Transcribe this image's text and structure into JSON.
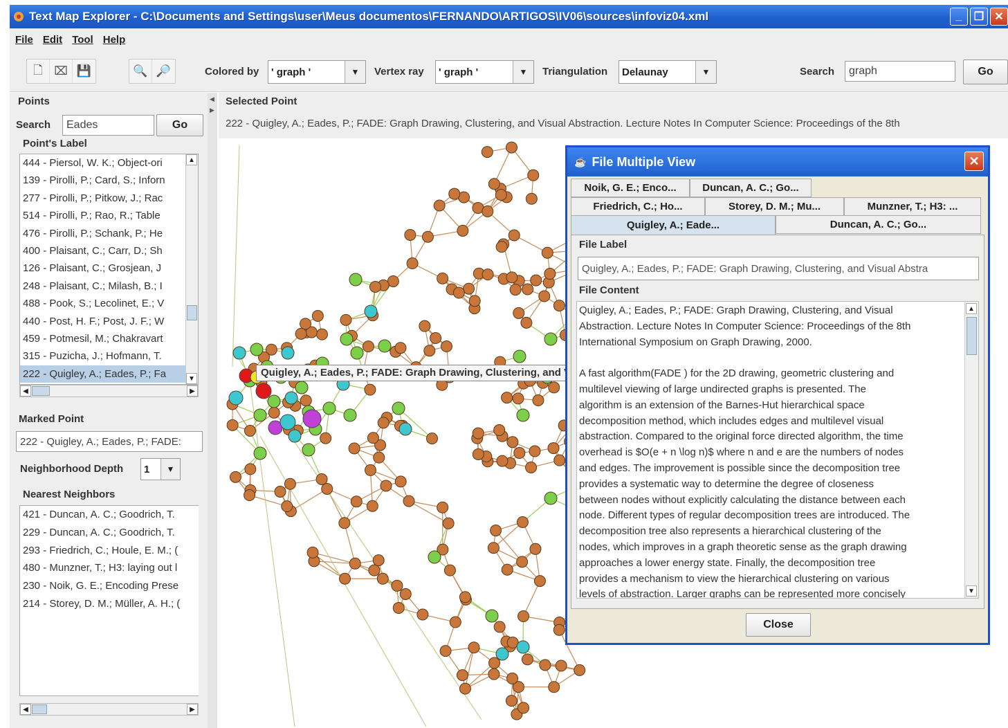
{
  "window": {
    "title": "Text Map Explorer - C:\\Documents and Settings\\user\\Meus documentos\\FERNANDO\\ARTIGOS\\IV06\\sources\\infoviz04.xml"
  },
  "menu": [
    "File",
    "Edit",
    "Tool",
    "Help"
  ],
  "toolbar": {
    "colored_by_label": "Colored by",
    "colored_by_value": "' graph '",
    "vertex_ray_label": "Vertex ray",
    "vertex_ray_value": "' graph '",
    "triangulation_label": "Triangulation",
    "triangulation_value": "Delaunay",
    "search_label": "Search",
    "search_value": "graph",
    "go_label": "Go"
  },
  "points_panel": {
    "title": "Points",
    "search_label": "Search",
    "search_value": "Eades",
    "go_label": "Go",
    "list_title": "Point's Label",
    "items": [
      "444 - Piersol, W. K.; Object-ori",
      "139 - Pirolli, P.; Card, S.; Inforn",
      "277 - Pirolli, P.; Pitkow, J.; Rac",
      "514 - Pirolli, P.; Rao, R.; Table",
      "476 - Pirolli, P.; Schank, P.; He",
      "400 - Plaisant, C.; Carr, D.; Sh",
      "126 - Plaisant, C.; Grosjean, J",
      "248 - Plaisant, C.; Milash, B.; I",
      "488 - Pook, S.; Lecolinet, E.; V",
      "440 - Post, H. F.; Post, J. F.; W",
      "459 - Potmesil, M.; Chakravart",
      "315 - Puzicha, J.; Hofmann, T.",
      "222 - Quigley, A.; Eades, P.; Fa"
    ],
    "selected_index": 12,
    "marked_title": "Marked Point",
    "marked_value": "222 - Quigley, A.; Eades, P.; FADE:",
    "depth_label": "Neighborhood Depth",
    "depth_value": "1",
    "neighbors_title": "Nearest Neighbors",
    "neighbors": [
      "421 - Duncan, A. C.; Goodrich, T.",
      "229 - Duncan, A. C.; Goodrich, T.",
      "293 - Friedrich, C.; Houle, E. M.; (",
      "480 - Munzner, T.; H3: laying out l",
      "230 - Noik, G. E.; Encoding Prese",
      "214 - Storey, D. M.; Müller, A. H.; ("
    ]
  },
  "selected_point": {
    "title": "Selected Point",
    "value": "222 - Quigley, A.; Eades, P.; FADE: Graph Drawing, Clustering, and Visual Abstraction. Lecture Notes In Computer Science: Proceedings of the 8th"
  },
  "tooltip": "Quigley, A.; Eades, P.; FADE: Graph Drawing, Clustering, and Visual Abstraction",
  "dialog": {
    "title": "File Multiple View",
    "tabs_row1": [
      "Noik, G. E.; Enco...",
      "Duncan, A. C.; Go..."
    ],
    "tabs_row2": [
      "Friedrich, C.; Ho...",
      "Storey, D. M.; Mu...",
      "Munzner, T.; H3: ..."
    ],
    "tabs_row3": [
      "Quigley, A.; Eade...",
      "Duncan, A. C.; Go..."
    ],
    "file_label_title": "File Label",
    "file_label_value": "Quigley, A.; Eades, P.; FADE: Graph Drawing, Clustering, and Visual Abstra",
    "file_content_title": "File Content",
    "file_content": "Quigley, A.; Eades, P.; FADE: Graph Drawing, Clustering, and Visual\nAbstraction. Lecture Notes In Computer Science: Proceedings of the 8th\nInternational Symposium on Graph Drawing, 2000.\n\nA fast algorithm(FADE ) for the 2D drawing, geometric clustering and\nmultilevel viewing of large undirected graphs is presented. The\nalgorithm is an extension of the Barnes-Hut hierarchical space\ndecomposition method, which includes edges and multilevel visual\nabstraction. Compared to the original force directed algorithm, the time\noverhead is $O(e + n \\log n)$ where n and e are the numbers of nodes\nand edges. The improvement is possible since the decomposition tree\nprovides a systematic way to determine the degree of closeness\nbetween nodes without explicitly calculating the distance between each\nnode. Different types of regular decomposition trees are introduced. The\ndecomposition tree also represents a hierarchical clustering of the\nnodes, which improves in a graph theoretic sense as the graph drawing\napproaches a lower energy state. Finally, the decomposition tree\nprovides a mechanism to view the hierarchical clustering on various\nlevels of abstraction. Larger graphs can be represented more concisely",
    "close_label": "Close"
  },
  "colors": {
    "node": "#c8763a",
    "edge": "#c88a55",
    "highlight_node": "#7ccf4a",
    "cyan_node": "#3fc7cf",
    "red_node": "#e01818",
    "purple_node": "#c040d8",
    "yellow_node": "#f2e620"
  }
}
